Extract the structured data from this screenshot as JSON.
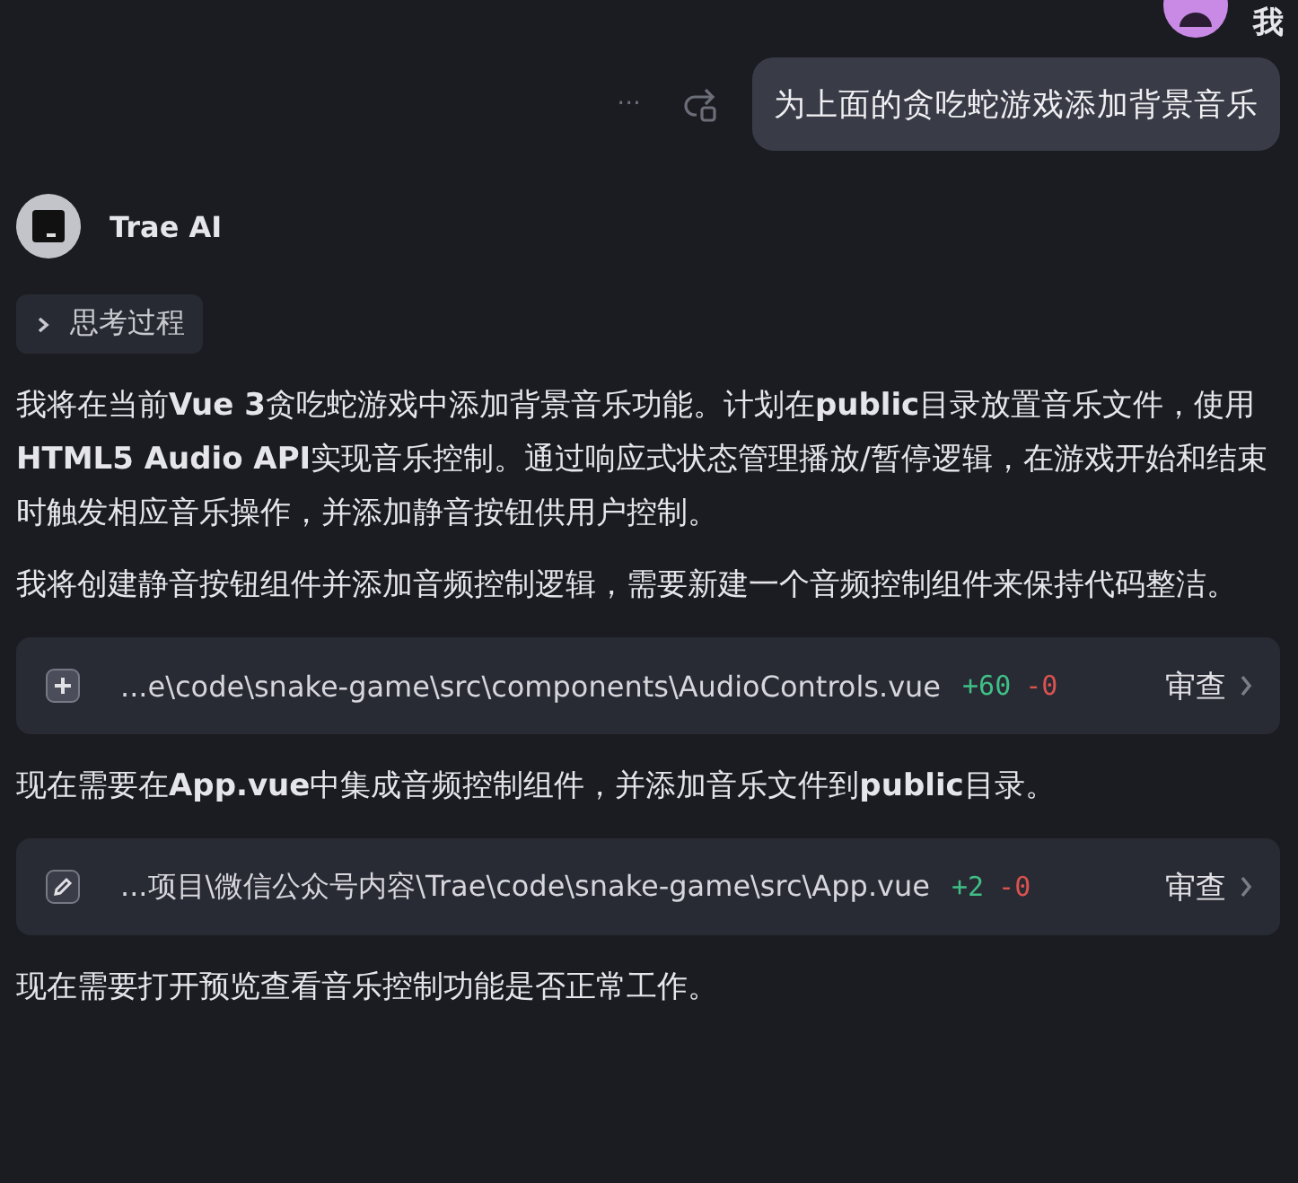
{
  "user": {
    "name": "我"
  },
  "user_message": {
    "text": "为上面的贪吃蛇游戏添加背景音乐",
    "more": "···"
  },
  "assistant": {
    "name": "Trae AI"
  },
  "thinking": {
    "label": "思考过程",
    "expanded": false
  },
  "blocks": [
    {
      "kind": "text",
      "text": "我将在当前**Vue 3**贪吃蛇游戏中添加背景音乐功能。计划在**public**目录放置音乐文件，使用**HTML5 Audio API**实现音乐控制。通过响应式状态管理播放/暂停逻辑，在游戏开始和结束时触发相应音乐操作，并添加静音按钮供用户控制。"
    },
    {
      "kind": "text",
      "text": "我将创建静音按钮组件并添加音频控制逻辑，需要新建一个音频控制组件来保持代码整洁。"
    },
    {
      "kind": "new_file",
      "path": "...e\\code\\snake-game\\src\\components\\AudioControls.vue",
      "added": "+60",
      "removed": "-0",
      "review": "审查"
    },
    {
      "kind": "text",
      "text": "现在需要在**App.vue**中集成音频控制组件，并添加音乐文件到**public**目录。"
    },
    {
      "kind": "edited_file",
      "path": "...项目\\微信公众号内容\\Trae\\code\\snake-game\\src\\App.vue",
      "added": "+2",
      "removed": "-0",
      "review": "审查"
    },
    {
      "kind": "text",
      "text": "现在需要打开预览查看音乐控制功能是否正常工作。"
    }
  ]
}
